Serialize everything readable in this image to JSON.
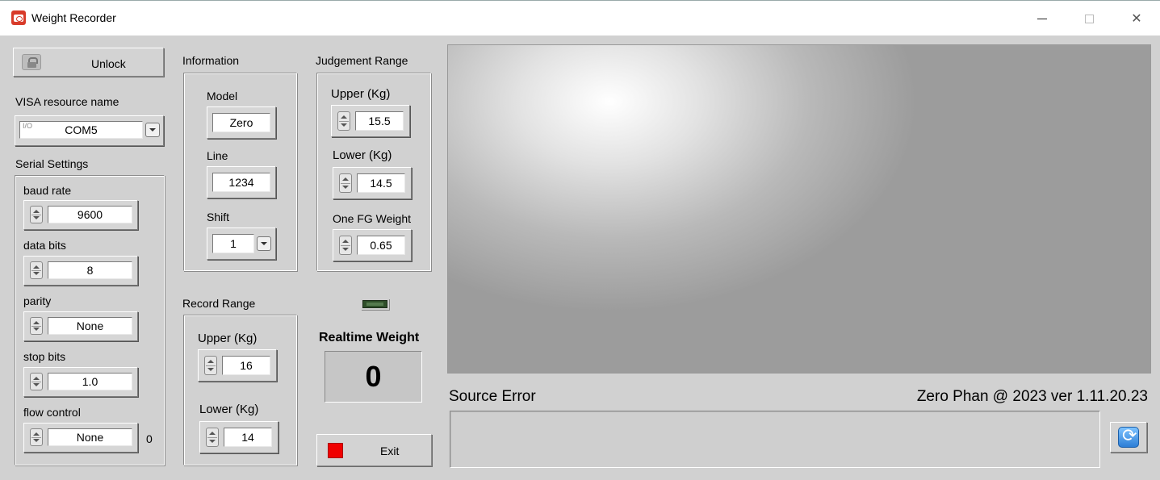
{
  "window": {
    "title": "Weight Recorder"
  },
  "unlock": {
    "label": "Unlock"
  },
  "visa": {
    "label": "VISA resource name",
    "value": "COM5",
    "io_glyph": "I/O"
  },
  "serial": {
    "title": "Serial Settings",
    "baud_label": "baud rate",
    "baud_value": "9600",
    "databits_label": "data bits",
    "databits_value": "8",
    "parity_label": "parity",
    "parity_value": "None",
    "stopbits_label": "stop bits",
    "stopbits_value": "1.0",
    "flow_label": "flow control",
    "flow_value": "None",
    "flow_extra": "0"
  },
  "information": {
    "title": "Information",
    "model_label": "Model",
    "model_value": "Zero",
    "line_label": "Line",
    "line_value": "1234",
    "shift_label": "Shift",
    "shift_value": "1"
  },
  "judgement": {
    "title": "Judgement Range",
    "upper_label": "Upper (Kg)",
    "upper_value": "15.5",
    "lower_label": "Lower (Kg)",
    "lower_value": "14.5",
    "fg_label": "One FG Weight",
    "fg_value": "0.65"
  },
  "record": {
    "title": "Record Range",
    "upper_label": "Upper (Kg)",
    "upper_value": "16",
    "lower_label": "Lower (Kg)",
    "lower_value": "14"
  },
  "realtime": {
    "label": "Realtime Weight",
    "value": "0"
  },
  "exit": {
    "label": "Exit"
  },
  "source_error": {
    "label": "Source Error",
    "value": ""
  },
  "footer": {
    "credit": "Zero Phan @ 2023 ver 1.11.20.23"
  },
  "colors": {
    "exit_indicator": "#f00000",
    "led": "#2f4f2a",
    "background": "#d1d1d1"
  },
  "icons": {
    "app": "scale-icon",
    "lock": "lock-icon",
    "refresh": "refresh-icon"
  }
}
